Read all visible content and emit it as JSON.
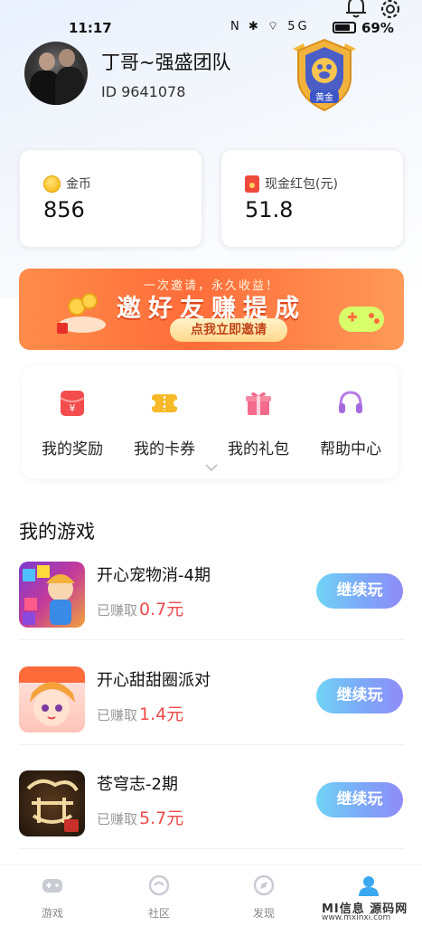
{
  "status_bar": {
    "time": "11:17",
    "indicators": "N ✱ ⌔ 5G",
    "battery": "69%"
  },
  "header": {
    "notification_icon": "bell-icon",
    "settings_icon": "gear-icon"
  },
  "user": {
    "name": "丁哥~强盛团队",
    "id": "ID 9641078",
    "level_badge": "黄金"
  },
  "balances": {
    "coins_label": "金币",
    "coins_value": "856",
    "cash_label": "现金红包(元)",
    "cash_value": "51.8"
  },
  "banner": {
    "subtitle": "一次邀请，永久收益！",
    "title": "邀好友赚提成",
    "button": "点我立即邀请"
  },
  "quick_actions": [
    {
      "label": "我的奖励",
      "icon": "reward-icon"
    },
    {
      "label": "我的卡券",
      "icon": "coupon-icon"
    },
    {
      "label": "我的礼包",
      "icon": "gift-icon"
    },
    {
      "label": "帮助中心",
      "icon": "headset-icon"
    }
  ],
  "games_section": {
    "title": "我的游戏",
    "earned_prefix": "已赚取",
    "items": [
      {
        "name": "开心宠物消-4期",
        "amount": "0.7元",
        "button": "继续玩"
      },
      {
        "name": "开心甜甜圈派对",
        "amount": "1.4元",
        "button": "继续玩"
      },
      {
        "name": "苍穹志-2期",
        "amount": "5.7元",
        "button": "继续玩"
      }
    ]
  },
  "tabbar": {
    "tabs": [
      {
        "label": "游戏",
        "icon": "gamepad-icon"
      },
      {
        "label": "社区",
        "icon": "community-icon"
      },
      {
        "label": "发现",
        "icon": "compass-icon"
      },
      {
        "label": "",
        "icon": "user-icon",
        "active": true
      }
    ]
  },
  "watermark": {
    "line1": "MI信息 源码网",
    "line2": "www.mxinxi.com"
  },
  "colors": {
    "accent_red": "#ef4a4a",
    "button_gradient_start": "#6fd3f5",
    "button_gradient_end": "#8f8cf7",
    "banner_orange": "#ff6d3a",
    "active_tab": "#2d9ef2"
  }
}
